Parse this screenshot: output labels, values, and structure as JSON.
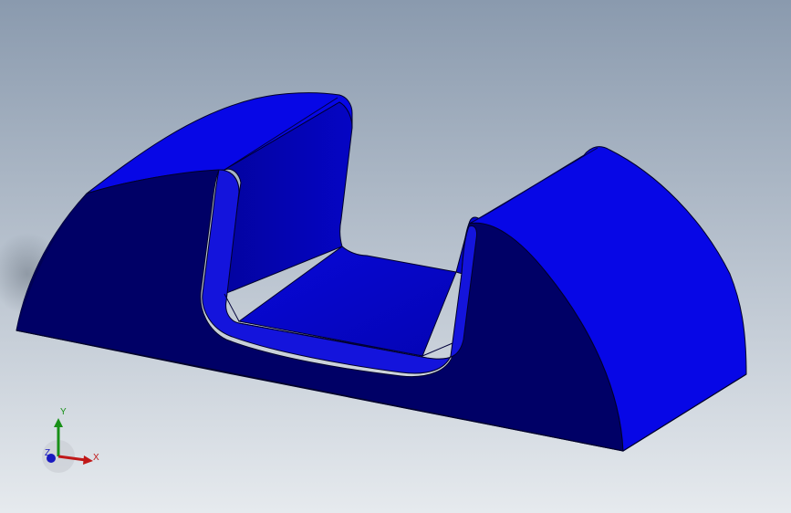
{
  "viewport": {
    "background_top": "#8a9aae",
    "background_bottom": "#e6eaee"
  },
  "model": {
    "name": "u-shaped-saddle-part",
    "face_colors": {
      "top_face": "#0707e6",
      "side_face": "#000066",
      "inner_wall": "#0404b8",
      "channel_floor": "#0505cc",
      "fillet": "#1010d8",
      "edge": "#00002a"
    }
  },
  "triad": {
    "x_label": "X",
    "y_label": "Y",
    "z_label": "Z",
    "colors": {
      "x": "#c01818",
      "y": "#189018",
      "z": "#1818c0"
    }
  }
}
